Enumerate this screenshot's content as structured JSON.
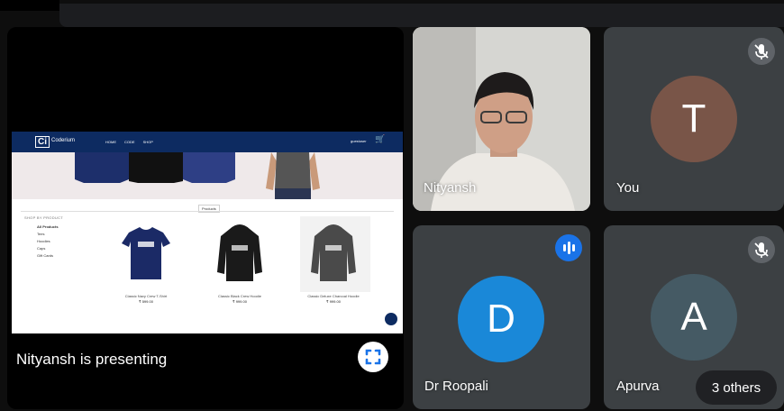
{
  "presentation": {
    "presenting_label": "Nityansh is presenting",
    "shared_site": {
      "logo_mark": "Ci",
      "logo_name": "Coderium",
      "nav_links": [
        "HOME",
        "CODE",
        "SHOP"
      ],
      "user_menu": "guestuser",
      "products_tab": "Products",
      "categories_title": "SHOP BY PRODUCT",
      "categories": [
        "All Products",
        "Tees",
        "Hoodies",
        "Caps",
        "Gift Cards"
      ],
      "products": [
        {
          "name": "Classic Navy Crew T-Shirt",
          "price": "₹ 599.00"
        },
        {
          "name": "Classic Black Crew Hoodie",
          "price": "₹ 999.00"
        },
        {
          "name": "Classic Deluxe Charcoal Hoodie",
          "price": "₹ 999.00"
        }
      ]
    }
  },
  "participants": [
    {
      "name": "Nityansh",
      "initial": "",
      "avatar_color": "",
      "video": true
    },
    {
      "name": "You",
      "initial": "T",
      "avatar_color": "#795548",
      "muted": true
    },
    {
      "name": "Dr Roopali",
      "initial": "D",
      "avatar_color": "#1a88d8",
      "speaking": true
    },
    {
      "name": "Apurva",
      "initial": "A",
      "avatar_color": "#455a64",
      "muted": true
    }
  ],
  "others_label": "3 others",
  "icons": {
    "fullscreen": "fullscreen-icon",
    "mic_off": "mic-off-icon",
    "speaking": "audio-level-icon"
  }
}
